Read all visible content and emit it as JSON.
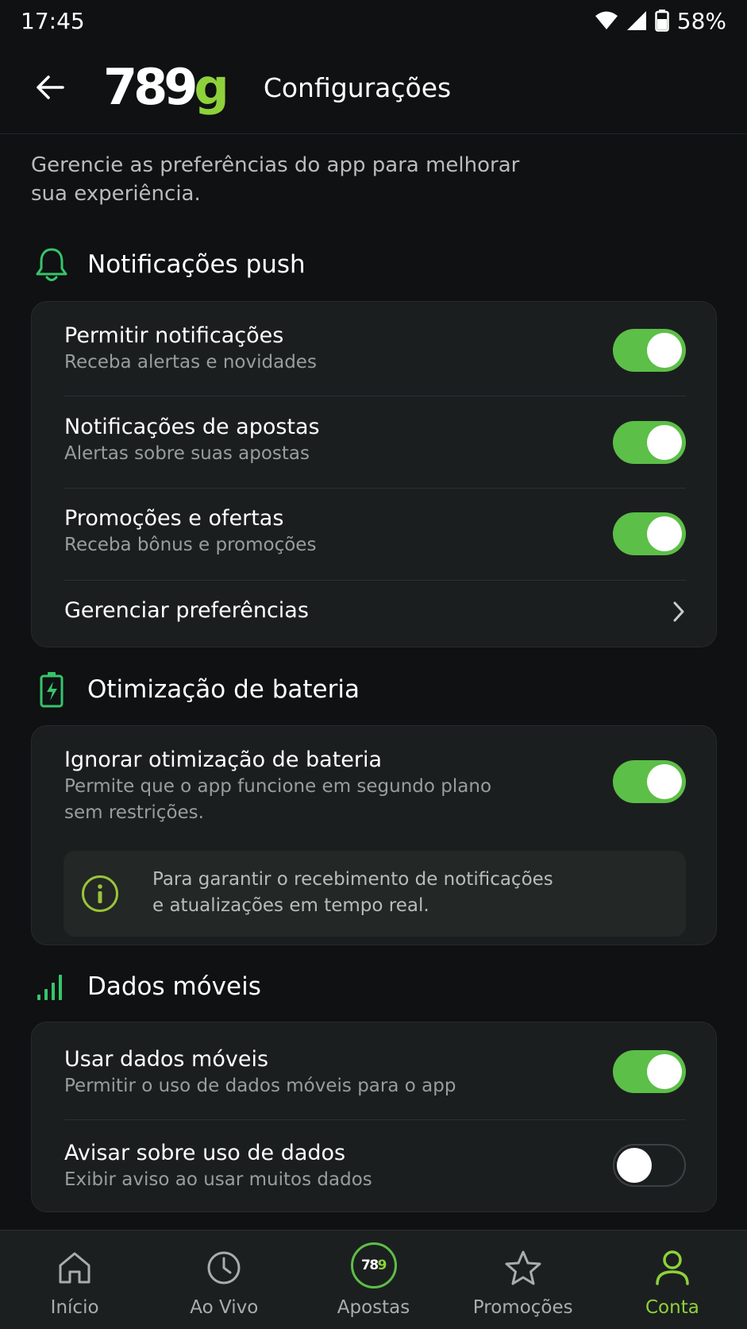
{
  "status_bar": {
    "time": "17:45",
    "battery": "58%"
  },
  "header": {
    "logo_main": "789",
    "logo_accent": "g",
    "title": "Configurações"
  },
  "intro": "Gerencie as preferências do app para melhorar sua experiência.",
  "sections": {
    "push": {
      "title": "Notificações push",
      "rows": [
        {
          "title": "Permitir notificações",
          "subtitle": "Receba alertas e novidades",
          "enabled": true
        },
        {
          "title": "Notificações de apostas",
          "subtitle": "Alertas sobre suas apostas",
          "enabled": true
        },
        {
          "title": "Promoções e ofertas",
          "subtitle": "Receba bônus e promoções",
          "enabled": true
        }
      ],
      "manage_label": "Gerenciar preferências"
    },
    "battery": {
      "title": "Otimização de bateria",
      "row": {
        "title": "Ignorar otimização de bateria",
        "subtitle_line1": "Permite que o app funcione em segundo plano",
        "subtitle_line2": "sem restrições.",
        "enabled": true
      },
      "info_line1": "Para garantir o recebimento de notificações",
      "info_line2": "e atualizações em tempo real."
    },
    "data": {
      "title": "Dados móveis",
      "rows": [
        {
          "title": "Usar dados móveis",
          "subtitle": "Permitir o uso de dados móveis para o app",
          "enabled": true
        },
        {
          "title": "Avisar sobre uso de dados",
          "subtitle": "Exibir aviso ao usar muitos dados",
          "enabled": false
        }
      ]
    }
  },
  "bottom_nav": {
    "items": [
      {
        "label": "Início",
        "icon": "home-icon"
      },
      {
        "label": "Ao Vivo",
        "icon": "clock-icon"
      },
      {
        "label": "Apostas",
        "icon": "logo-789g-icon",
        "logo_main": "78",
        "logo_accent": "9"
      },
      {
        "label": "Promoções",
        "icon": "star-icon"
      },
      {
        "label": "Conta",
        "icon": "user-icon",
        "active": true
      }
    ]
  },
  "colors": {
    "background": "#0f1112",
    "card": "#1b1e1f",
    "accent_green": "#8ed13b",
    "toggle_on": "#5cbf47",
    "section_icon_green": "#37c46b"
  }
}
